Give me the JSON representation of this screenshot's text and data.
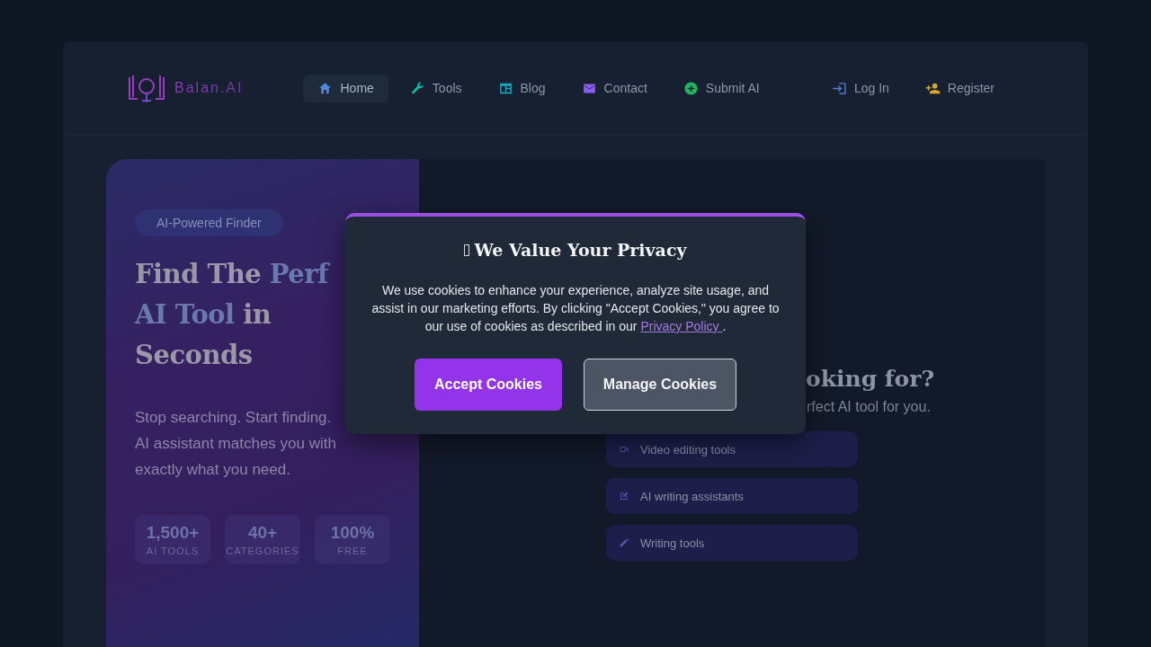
{
  "brand": {
    "name": "Balan.AI"
  },
  "nav": {
    "items": [
      {
        "label": "Home",
        "kind": "home",
        "color": "#4f86d9",
        "selected": true
      },
      {
        "label": "Tools",
        "kind": "wrench",
        "color": "#14b8a6",
        "selected": false
      },
      {
        "label": "Blog",
        "kind": "blog",
        "color": "#1ba6c4",
        "selected": false
      },
      {
        "label": "Contact",
        "kind": "mail",
        "color": "#8b5cf6",
        "selected": false
      },
      {
        "label": "Submit AI",
        "kind": "plus",
        "color": "#22b35e",
        "selected": false
      }
    ],
    "auth": [
      {
        "label": "Log In",
        "kind": "login",
        "color": "#4f7fd9"
      },
      {
        "label": "Register",
        "kind": "user-plus",
        "color": "#d4a72c"
      }
    ]
  },
  "hero": {
    "badge": "AI-Powered Finder",
    "heading": [
      [
        {
          "text": "Find The ",
          "accent": false
        },
        {
          "text": "Perf",
          "accent": true
        }
      ],
      [
        {
          "text": "AI Tool",
          "accent": true
        },
        {
          "text": " in",
          "accent": false
        }
      ],
      [
        {
          "text": "Seconds",
          "accent": false
        }
      ]
    ],
    "subtitle_lines": [
      "Stop searching. Start finding.",
      "AI assistant matches you with",
      "exactly what you need."
    ],
    "stats": [
      {
        "value": "1,500+",
        "label": "AI TOOLS"
      },
      {
        "value": "40+",
        "label": "CATEGORIES"
      },
      {
        "value": "100%",
        "label": "FREE"
      }
    ]
  },
  "search_panel": {
    "heading": "oking for?",
    "subheading": "rfect AI tool for you.",
    "suggestions": [
      {
        "kind": "video",
        "label": "Video editing tools"
      },
      {
        "kind": "edit",
        "label": "AI writing assistants"
      },
      {
        "kind": "pencil",
        "label": "Writing tools"
      }
    ]
  },
  "cookie_modal": {
    "title": "We Value Your Privacy",
    "body": "We use cookies to enhance your experience, analyze site usage, and assist in our marketing efforts. By clicking \"Accept Cookies,\" you agree to our use of cookies as described in our ",
    "link": "Privacy Policy ",
    "body_end": ".",
    "buttons": [
      {
        "label": "Accept Cookies",
        "kind": "primary"
      },
      {
        "label": "Manage Cookies",
        "kind": "secondary"
      }
    ]
  }
}
